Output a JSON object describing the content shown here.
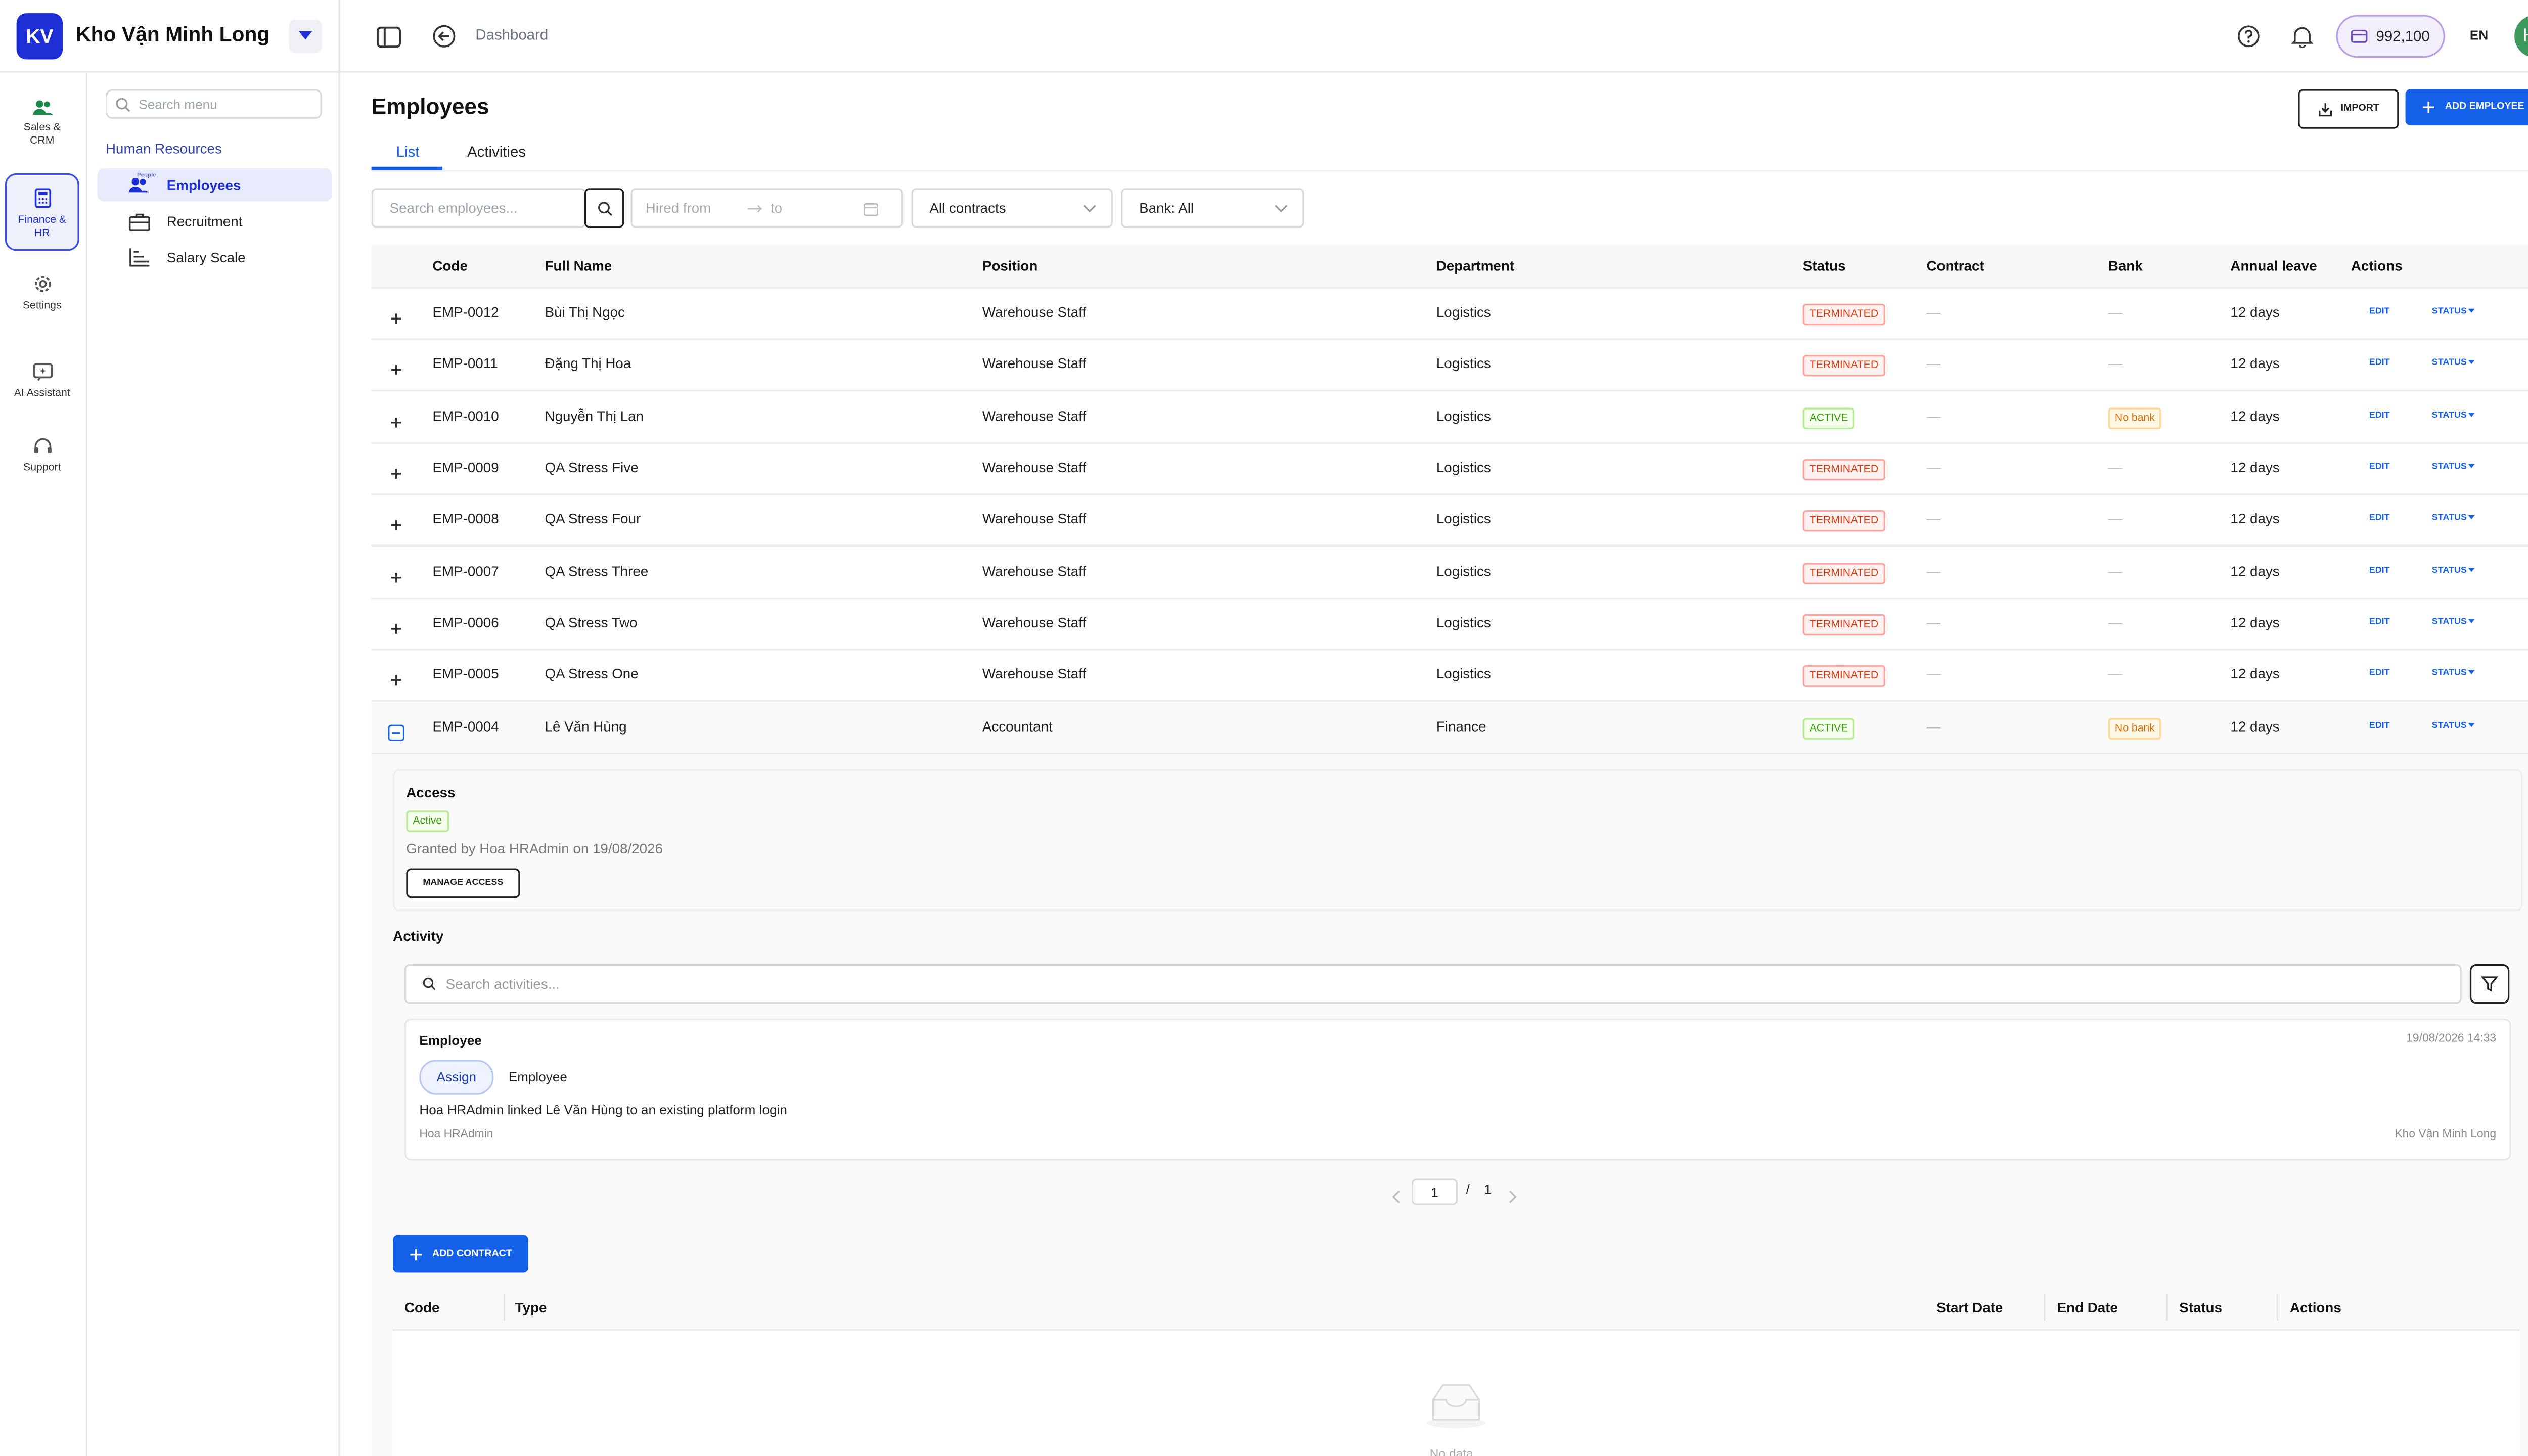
{
  "header": {
    "logo": "KV",
    "company": "Kho Vận Minh Long",
    "breadcrumb": "Dashboard",
    "credits": "992,100",
    "language": "EN",
    "avatar": "HH"
  },
  "rail": {
    "items": [
      {
        "label": "Sales &\nCRM",
        "icon": "people-icon"
      },
      {
        "label": "Finance &\nHR",
        "icon": "calculator-icon",
        "active": true
      },
      {
        "label": "Settings",
        "icon": "gear-icon"
      },
      {
        "label": "AI Assistant",
        "icon": "ai-icon"
      },
      {
        "label": "Support",
        "icon": "headset-icon"
      }
    ]
  },
  "menu": {
    "search_placeholder": "Search menu",
    "group": "Human Resources",
    "tiny_label": "People",
    "items": [
      {
        "label": "Employees",
        "icon": "people-icon",
        "active": true
      },
      {
        "label": "Recruitment",
        "icon": "briefcase-icon"
      },
      {
        "label": "Salary Scale",
        "icon": "scale-icon"
      }
    ]
  },
  "page": {
    "title": "Employees",
    "import_label": "IMPORT",
    "add_employee_label": "ADD EMPLOYEE",
    "tabs": [
      "List",
      "Activities"
    ]
  },
  "filters": {
    "search_placeholder": "Search employees...",
    "hired_from_placeholder": "Hired from",
    "to_placeholder": "to",
    "contracts": "All contracts",
    "bank": "Bank: All"
  },
  "table": {
    "columns": [
      "Code",
      "Full Name",
      "Position",
      "Department",
      "Status",
      "Contract",
      "Bank",
      "Annual leave",
      "Actions"
    ],
    "edit_label": "EDIT",
    "status_label": "STATUS",
    "rows": [
      {
        "code": "EMP-0012",
        "name": "Bùi Thị Ngọc",
        "position": "Warehouse Staff",
        "department": "Logistics",
        "status": "TERMINATED",
        "contract": "—",
        "bank": "—",
        "leave": "12 days"
      },
      {
        "code": "EMP-0011",
        "name": "Đặng Thị Hoa",
        "position": "Warehouse Staff",
        "department": "Logistics",
        "status": "TERMINATED",
        "contract": "—",
        "bank": "—",
        "leave": "12 days"
      },
      {
        "code": "EMP-0010",
        "name": "Nguyễn Thị Lan",
        "position": "Warehouse Staff",
        "department": "Logistics",
        "status": "ACTIVE",
        "contract": "—",
        "bank": "No bank",
        "leave": "12 days"
      },
      {
        "code": "EMP-0009",
        "name": "QA Stress Five",
        "position": "Warehouse Staff",
        "department": "Logistics",
        "status": "TERMINATED",
        "contract": "—",
        "bank": "—",
        "leave": "12 days"
      },
      {
        "code": "EMP-0008",
        "name": "QA Stress Four",
        "position": "Warehouse Staff",
        "department": "Logistics",
        "status": "TERMINATED",
        "contract": "—",
        "bank": "—",
        "leave": "12 days"
      },
      {
        "code": "EMP-0007",
        "name": "QA Stress Three",
        "position": "Warehouse Staff",
        "department": "Logistics",
        "status": "TERMINATED",
        "contract": "—",
        "bank": "—",
        "leave": "12 days"
      },
      {
        "code": "EMP-0006",
        "name": "QA Stress Two",
        "position": "Warehouse Staff",
        "department": "Logistics",
        "status": "TERMINATED",
        "contract": "—",
        "bank": "—",
        "leave": "12 days"
      },
      {
        "code": "EMP-0005",
        "name": "QA Stress One",
        "position": "Warehouse Staff",
        "department": "Logistics",
        "status": "TERMINATED",
        "contract": "—",
        "bank": "—",
        "leave": "12 days"
      },
      {
        "code": "EMP-0004",
        "name": "Lê Văn Hùng",
        "position": "Accountant",
        "department": "Finance",
        "status": "ACTIVE",
        "contract": "—",
        "bank": "No bank",
        "leave": "12 days",
        "expanded": true
      }
    ]
  },
  "detail": {
    "access_title": "Access",
    "access_status": "Active",
    "granted_text": "Granted by Hoa HRAdmin on 19/08/2026",
    "manage_access_label": "MANAGE ACCESS",
    "activity_title": "Activity",
    "activity_search_placeholder": "Search activities...",
    "entry": {
      "type": "Employee",
      "timestamp": "19/08/2026 14:33",
      "action_pill": "Assign",
      "target": "Employee",
      "message": "Hoa HRAdmin linked Lê Văn Hùng to an existing platform login",
      "actor": "Hoa HRAdmin",
      "company": "Kho Vận Minh Long"
    },
    "pagination": {
      "current": "1",
      "separator": "/",
      "total": "1"
    },
    "add_contract_label": "ADD CONTRACT",
    "contract_columns": [
      "Code",
      "Type",
      "Start Date",
      "End Date",
      "Status",
      "Actions"
    ],
    "empty_text": "No data"
  },
  "colors": {
    "primary": "#1560e8",
    "brand": "#1d2fd4",
    "terminated": "#d4380d",
    "active": "#389e0d",
    "no_bank": "#d46b08",
    "avatar": "#3e9a5c"
  }
}
